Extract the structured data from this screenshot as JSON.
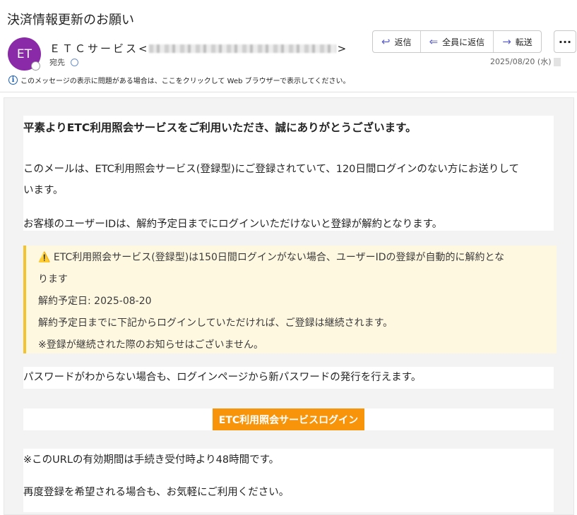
{
  "subject": "決済情報更新のお願い",
  "sender": {
    "avatar_initials": "ET",
    "name": "ＥＴＣサービス",
    "email_open": "<",
    "email_close": ">",
    "to_label": "宛先"
  },
  "actions": {
    "reply": "返信",
    "reply_all": "全員に返信",
    "forward": "転送"
  },
  "date": "2025/08/20 (水)",
  "info_bar": "このメッセージの表示に問題がある場合は、ここをクリックして Web ブラウザーで表示してください。",
  "body": {
    "greeting": "平素よりETC利用照会サービスをご利用いただき、誠にありがとうございます。",
    "para1_line1": "このメールは、ETC利用照会サービス(登録型)にご登録されていて、120日間ログインのない方にお送りして",
    "para1_line2": "います。",
    "para2": "お客様のユーザーIDは、解約予定日までにログインいただけないと登録が解約となります。",
    "warning": {
      "line1": "⚠️ ETC利用照会サービス(登録型)は150日間ログインがない場合、ユーザーIDの登録が自動的に解約とな",
      "line2": "ります",
      "line3": "解約予定日: 2025-08-20",
      "line4": "解約予定日までに下記からログインしていただければ、ご登録は継続されます。",
      "line5": "※登録が継続された際のお知らせはございません。"
    },
    "para3": "パスワードがわからない場合も、ログインページから新パスワードの発行を行えます。",
    "login_button": "ETC利用照会サービスログイン",
    "para4": "※このURLの有効期間は手続き受付時より48時間です。",
    "para5": "再度登録を希望される場合も、お気軽にご利用ください。"
  },
  "colors": {
    "avatar": "#8b2aa8",
    "accent_icon": "#5b5fc7",
    "warning_bg": "#fff8e1",
    "warning_border": "#f4c430",
    "login_button_bg": "#f7940a"
  }
}
